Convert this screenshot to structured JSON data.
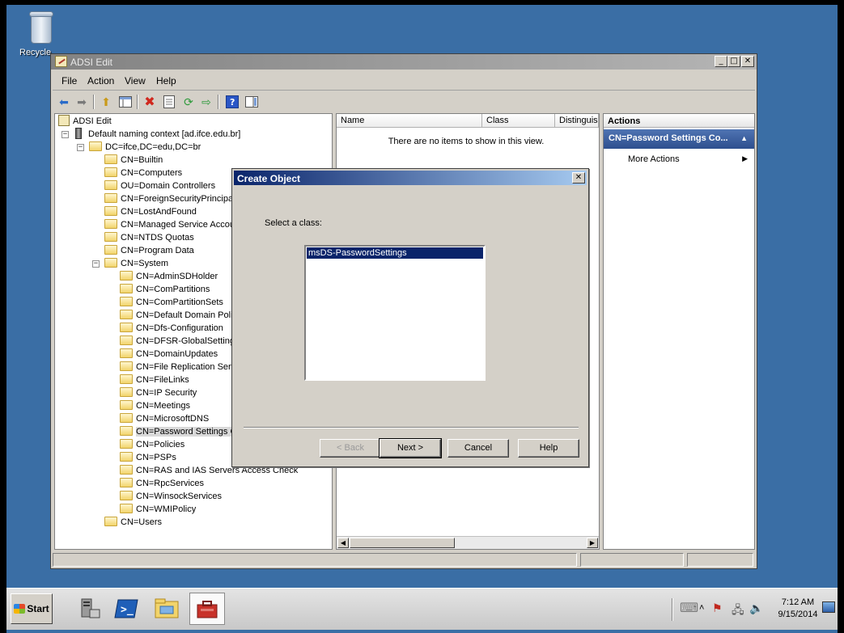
{
  "desktop": {
    "recycle_label": "Recycle"
  },
  "window": {
    "title": "ADSI Edit",
    "controls": {
      "minimize": "_",
      "maximize": "□",
      "close": "✕"
    }
  },
  "menu": [
    "File",
    "Action",
    "View",
    "Help"
  ],
  "tree": {
    "root": "ADSI Edit",
    "context": "Default naming context [ad.ifce.edu.br]",
    "domain": "DC=ifce,DC=edu,DC=br",
    "level1": [
      "CN=Builtin",
      "CN=Computers",
      "OU=Domain Controllers",
      "CN=ForeignSecurityPrincipals",
      "CN=LostAndFound",
      "CN=Managed Service Accour",
      "CN=NTDS Quotas",
      "CN=Program Data",
      "CN=System"
    ],
    "system_children": [
      "CN=AdminSDHolder",
      "CN=ComPartitions",
      "CN=ComPartitionSets",
      "CN=Default Domain Polic",
      "CN=Dfs-Configuration",
      "CN=DFSR-GlobalSettings",
      "CN=DomainUpdates",
      "CN=File Replication Servi",
      "CN=FileLinks",
      "CN=IP Security",
      "CN=Meetings",
      "CN=MicrosoftDNS",
      "CN=Password Settings C",
      "CN=Policies",
      "CN=PSPs",
      "CN=RAS and IAS Servers Access Check",
      "CN=RpcServices",
      "CN=WinsockServices",
      "CN=WMIPolicy"
    ],
    "users": "CN=Users"
  },
  "list": {
    "columns": [
      "Name",
      "Class",
      "Distinguish"
    ],
    "empty_message": "There are no items to show in this view."
  },
  "actions": {
    "header": "Actions",
    "section": "CN=Password Settings Co...",
    "more": "More Actions"
  },
  "dialog": {
    "title": "Create Object",
    "close": "✕",
    "prompt": "Select a class:",
    "classes": [
      "msDS-PasswordSettings"
    ],
    "buttons": {
      "back": "< Back",
      "next": "Next >",
      "cancel": "Cancel",
      "help": "Help"
    }
  },
  "taskbar": {
    "start": "Start",
    "time": "7:12 AM",
    "date": "9/15/2014"
  }
}
